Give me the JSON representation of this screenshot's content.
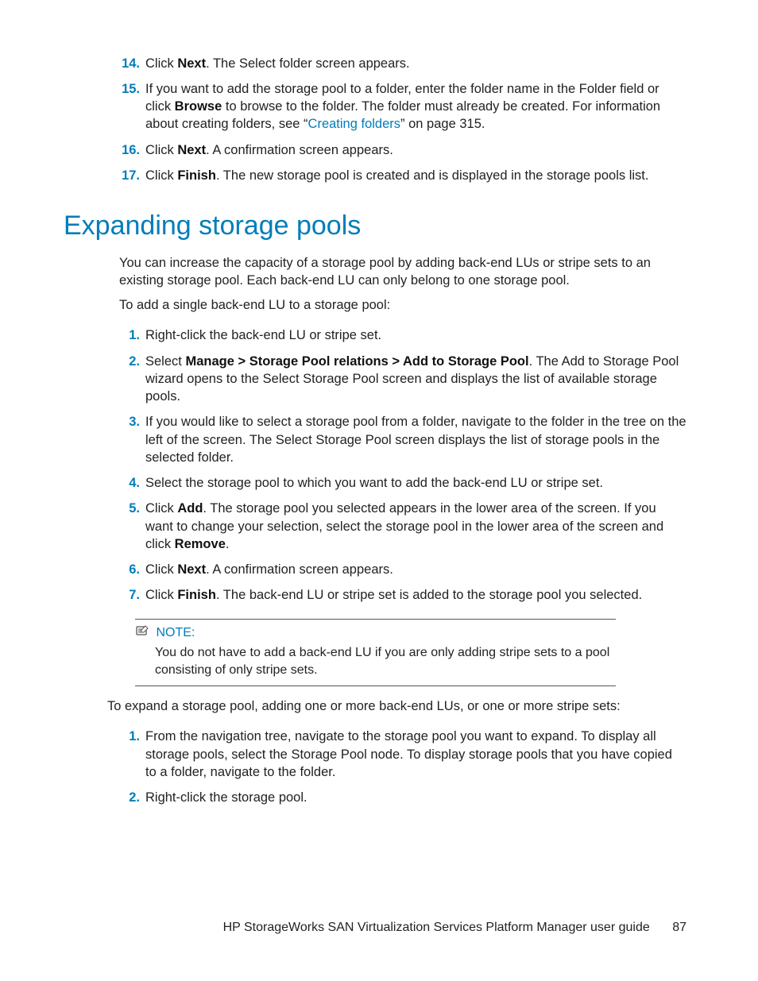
{
  "top_steps": [
    {
      "n": "14.",
      "pre": "Click ",
      "bold": "Next",
      "post": ". The Select folder screen appears."
    },
    {
      "n": "15.",
      "pre": "If you want to add the storage pool to a folder, enter the folder name in the Folder field or click ",
      "bold": "Browse",
      "post": " to browse to the folder. The folder must already be created. For information about creating folders, see “",
      "link": "Creating folders",
      "post2": "” on page 315."
    },
    {
      "n": "16.",
      "pre": "Click ",
      "bold": "Next",
      "post": ". A confirmation screen appears."
    },
    {
      "n": "17.",
      "pre": "Click ",
      "bold": "Finish",
      "post": ". The new storage pool is created and is displayed in the storage pools list."
    }
  ],
  "heading": "Expanding storage pools",
  "intro1": "You can increase the capacity of a storage pool by adding back-end LUs or stripe sets to an existing storage pool. Each back-end LU can only belong to one storage pool.",
  "intro2": "To add a single back-end LU to a storage pool:",
  "mid_steps": [
    {
      "n": "1.",
      "text": "Right-click the back-end LU or stripe set."
    },
    {
      "n": "2.",
      "pre": "Select ",
      "bold": "Manage > Storage Pool relations > Add to Storage Pool",
      "post": ". The Add to Storage Pool wizard opens to the Select Storage Pool screen and displays the list of available storage pools."
    },
    {
      "n": "3.",
      "text": "If you would like to select a storage pool from a folder, navigate to the folder in the tree on the left of the screen. The Select Storage Pool screen displays the list of storage pools in the selected folder."
    },
    {
      "n": "4.",
      "text": "Select the storage pool to which you want to add the back-end LU or stripe set."
    },
    {
      "n": "5.",
      "pre": "Click ",
      "bold": "Add",
      "post": ". The storage pool you selected appears in the lower area of the screen. If you want to change your selection, select the storage pool in the lower area of the screen and click ",
      "bold2": "Remove",
      "post2": "."
    },
    {
      "n": "6.",
      "pre": "Click ",
      "bold": "Next",
      "post": ". A confirmation screen appears."
    },
    {
      "n": "7.",
      "pre": "Click ",
      "bold": "Finish",
      "post": ". The back-end LU or stripe set is added to the storage pool you selected."
    }
  ],
  "note_label": "NOTE:",
  "note_body": "You do not have to add a back-end LU if you are only adding stripe sets to a pool consisting of only stripe sets.",
  "intro3": "To expand a storage pool, adding one or more back-end LUs, or one or more stripe sets:",
  "bot_steps": [
    {
      "n": "1.",
      "text": "From the navigation tree, navigate to the storage pool you want to expand. To display all storage pools, select the Storage Pool node. To display storage pools that you have copied to a folder, navigate to the folder."
    },
    {
      "n": "2.",
      "text": "Right-click the storage pool."
    }
  ],
  "footer_title": "HP StorageWorks SAN Virtualization Services Platform Manager user guide",
  "footer_page": "87"
}
